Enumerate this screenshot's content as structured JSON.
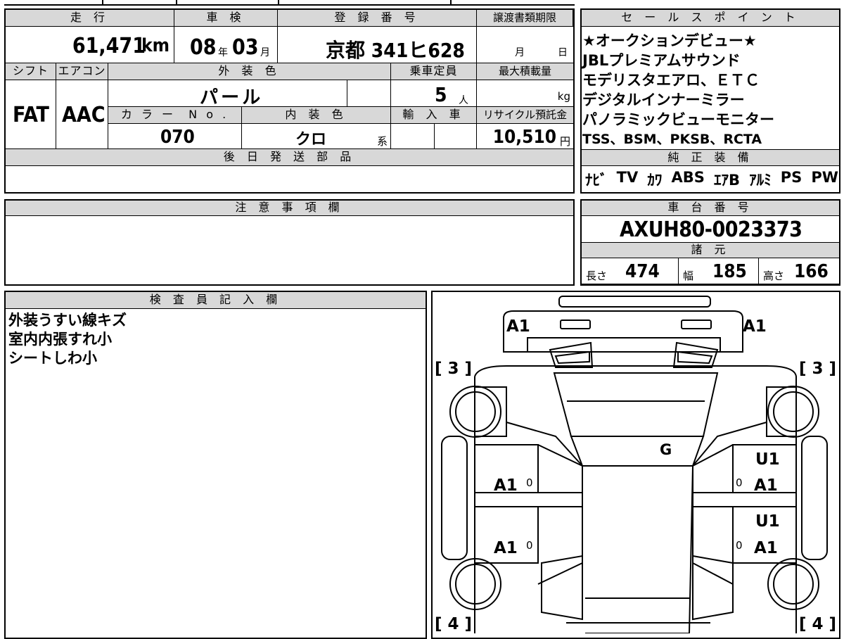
{
  "top": {
    "mileage_label": "走 行",
    "mileage_value": "61,471",
    "mileage_unit": "km",
    "inspection_label": "車 検",
    "inspection_year": "08",
    "inspection_year_unit": "年",
    "inspection_month": "03",
    "inspection_month_unit": "月",
    "registration_label": "登 録 番 号",
    "registration_value": "京都 341ヒ628",
    "transfer_deadline_label": "譲渡書類期限",
    "transfer_month_unit": "月",
    "transfer_day_unit": "日"
  },
  "row2": {
    "shift_label": "シフト",
    "shift_value": "FAT",
    "ac_label": "エアコン",
    "ac_value": "AAC",
    "exterior_color_label": "外 装 色",
    "exterior_color_value": "パ ー ル",
    "capacity_label": "乗車定員",
    "capacity_value": "5",
    "capacity_unit": "人",
    "max_load_label": "最大積載量",
    "max_load_unit": "kg",
    "color_no_label": "カ ラ ー  N o .",
    "color_no_value": "070",
    "interior_color_label": "内 装 色",
    "interior_color_value": "クロ",
    "interior_color_suffix": "系",
    "import_label": "輸 入 車",
    "recycle_label": "リサイクル預託金",
    "recycle_value": "10,510",
    "recycle_unit": "円"
  },
  "later_parts": {
    "label": "後 日 発 送 部 品"
  },
  "sales_points": {
    "label": "セ ー ル ス ポ イ ン ト",
    "lines": [
      "★オークションデビュー★",
      "JBLプレミアムサウンド",
      "モデリスタエアロ、ＥＴＣ",
      "デジタルインナーミラー",
      "パノラミックビューモニター",
      "TSS、BSM、PKSB、RCTA"
    ]
  },
  "standard_equipment": {
    "label": "純 正 装 備",
    "items": [
      "ﾅﾋﾞ",
      "TV",
      "ｶﾜ",
      "ABS",
      "ｴｱB",
      "ｱﾙﾐ",
      "PS",
      "PW"
    ]
  },
  "notes": {
    "label": "注 意 事 項 欄"
  },
  "chassis": {
    "label": "車 台 番 号",
    "value": "AXUH80-0023373"
  },
  "specs": {
    "label": "諸 元",
    "length_label": "長さ",
    "length_value": "474",
    "width_label": "幅",
    "width_value": "185",
    "height_label": "高さ",
    "height_value": "166"
  },
  "inspector": {
    "label": "検 査 員 記 入 欄",
    "lines": [
      "外装うすい線キズ",
      "室内内張すれ小",
      "シートしわ小"
    ]
  },
  "diagram": {
    "top_left": "A1",
    "top_right": "A1",
    "bracket_tl": "3",
    "bracket_tr": "3",
    "bracket_bl": "4",
    "bracket_br": "4",
    "glass": "G",
    "left_front_door": "A1",
    "left_rear_door": "A1",
    "right_front_door_top": "U1",
    "right_front_door": "A1",
    "right_rear_door_top": "U1",
    "right_rear_door": "A1",
    "zero": "0"
  }
}
